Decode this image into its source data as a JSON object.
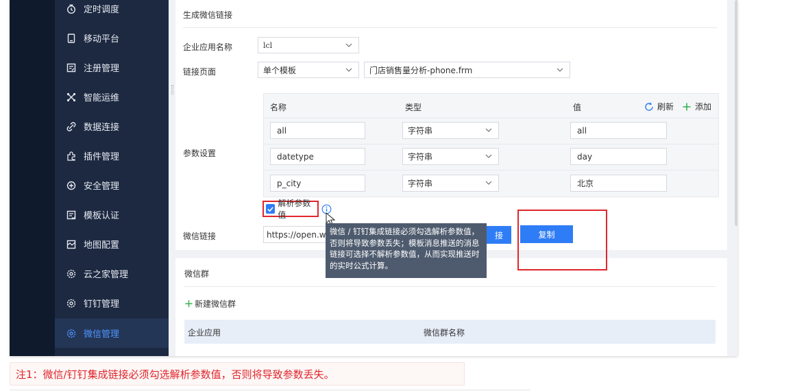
{
  "sidebar": {
    "items": [
      {
        "label": "定时调度",
        "icon": "clock-icon"
      },
      {
        "label": "移动平台",
        "icon": "tablet-icon"
      },
      {
        "label": "注册管理",
        "icon": "registration-icon"
      },
      {
        "label": "智能运维",
        "icon": "operations-icon"
      },
      {
        "label": "数据连接",
        "icon": "link-icon"
      },
      {
        "label": "插件管理",
        "icon": "plugin-icon"
      },
      {
        "label": "安全管理",
        "icon": "shield-icon"
      },
      {
        "label": "模板认证",
        "icon": "template-icon"
      },
      {
        "label": "地图配置",
        "icon": "map-icon"
      },
      {
        "label": "云之家管理",
        "icon": "gear-icon"
      },
      {
        "label": "钉钉管理",
        "icon": "gear-icon"
      },
      {
        "label": "微信管理",
        "icon": "gear-icon"
      }
    ],
    "active_index": 11
  },
  "link_panel": {
    "title": "生成微信链接",
    "app_label": "企业应用名称",
    "app_value": "lcl",
    "page_label": "链接页面",
    "page_type_value": "单个模板",
    "page_template_value": "门店销售量分析-phone.frm",
    "params_label": "参数设置",
    "table": {
      "headers": [
        "名称",
        "类型",
        "值"
      ],
      "refresh_label": "刷新",
      "add_label": "添加",
      "rows": [
        {
          "name": "all",
          "type": "字符串",
          "value": "all"
        },
        {
          "name": "datetype",
          "type": "字符串",
          "value": "day"
        },
        {
          "name": "p_city",
          "type": "字符串",
          "value": "北京"
        }
      ]
    },
    "parse_checkbox_label": "解析参数值",
    "parse_checked": true,
    "wechat_link_label": "微信链接",
    "wechat_link_value": "https://open.weixin.qq.com/connect/oauth2",
    "generate_button_partial": "接",
    "copy_button": "复制",
    "tooltip": "微信 / 钉钉集成链接必须勾选解析参数值，否则将导致参数丢失；模板消息推送的消息链接可选择不解析参数值，从而实现推送时的实时公式计算。"
  },
  "group_panel": {
    "title": "微信群",
    "new_group": "新建微信群",
    "headers": [
      "企业应用",
      "微信群名称"
    ]
  },
  "note": "注1：微信/钉钉集成链接必须勾选解析参数值，否则将导致参数丢失。",
  "colors": {
    "accent": "#2f7df6",
    "highlight": "#e0252b",
    "sidebar": "#1d2941",
    "add_green": "#2bb24c"
  }
}
